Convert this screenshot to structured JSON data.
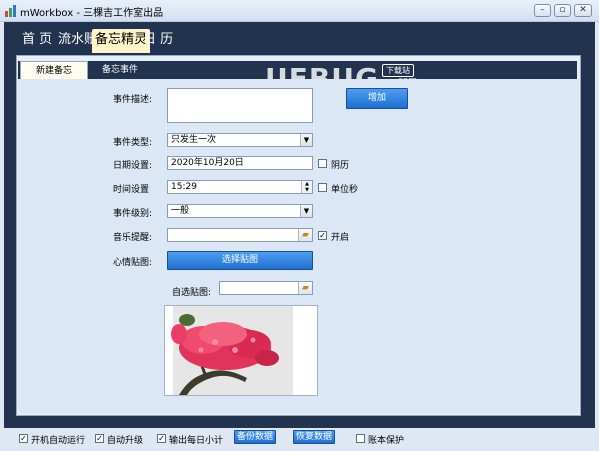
{
  "window": {
    "title": "mWorkbox - 三棵吉工作室出品",
    "buttons": {
      "minimize": "–",
      "restore": "▫",
      "close": "✕"
    }
  },
  "nav": {
    "tabs": [
      {
        "label": "首 页"
      },
      {
        "label": "流水账"
      },
      {
        "label": "备忘精灵",
        "active": true
      },
      {
        "label": "日 历"
      }
    ]
  },
  "subtabs": [
    {
      "label": "新建备忘",
      "active": true
    },
    {
      "label": "备忘事件"
    }
  ],
  "watermark": {
    "text": "UEBUG",
    "badge": "下载站",
    "suffix": ".com"
  },
  "form": {
    "description_label": "事件描述:",
    "description_value": "",
    "add_button": "增加",
    "type_label": "事件类型:",
    "type_value": "只发生一次",
    "date_label": "日期设置:",
    "date_value": "2020年10月20日",
    "lunar_label": "阴历",
    "lunar_checked": false,
    "time_label": "时间设置",
    "time_value": "15:29",
    "unit_sec_label": "单位秒",
    "unit_sec_checked": false,
    "level_label": "事件级别:",
    "level_value": "一般",
    "music_label": "音乐提醒:",
    "music_value": "",
    "enable_label": "开启",
    "enable_checked": true,
    "mood_label": "心情贴图:",
    "choose_image_button": "选择贴图",
    "custom_image_label": "自选贴图:",
    "custom_image_value": ""
  },
  "statusbar": {
    "autostart_label": "开机自动运行",
    "autostart_checked": true,
    "autoupgrade_label": "自动升级",
    "autoupgrade_checked": true,
    "daily_summary_label": "输出每日小计",
    "daily_summary_checked": true,
    "backup_button": "备份数据",
    "restore_button": "恢复数据",
    "protect_label": "账本保护",
    "protect_checked": false
  },
  "colors": {
    "frame_dark": "#22334f",
    "active_tab": "#fdf5c9",
    "accent_button": "#2a7fe0"
  }
}
